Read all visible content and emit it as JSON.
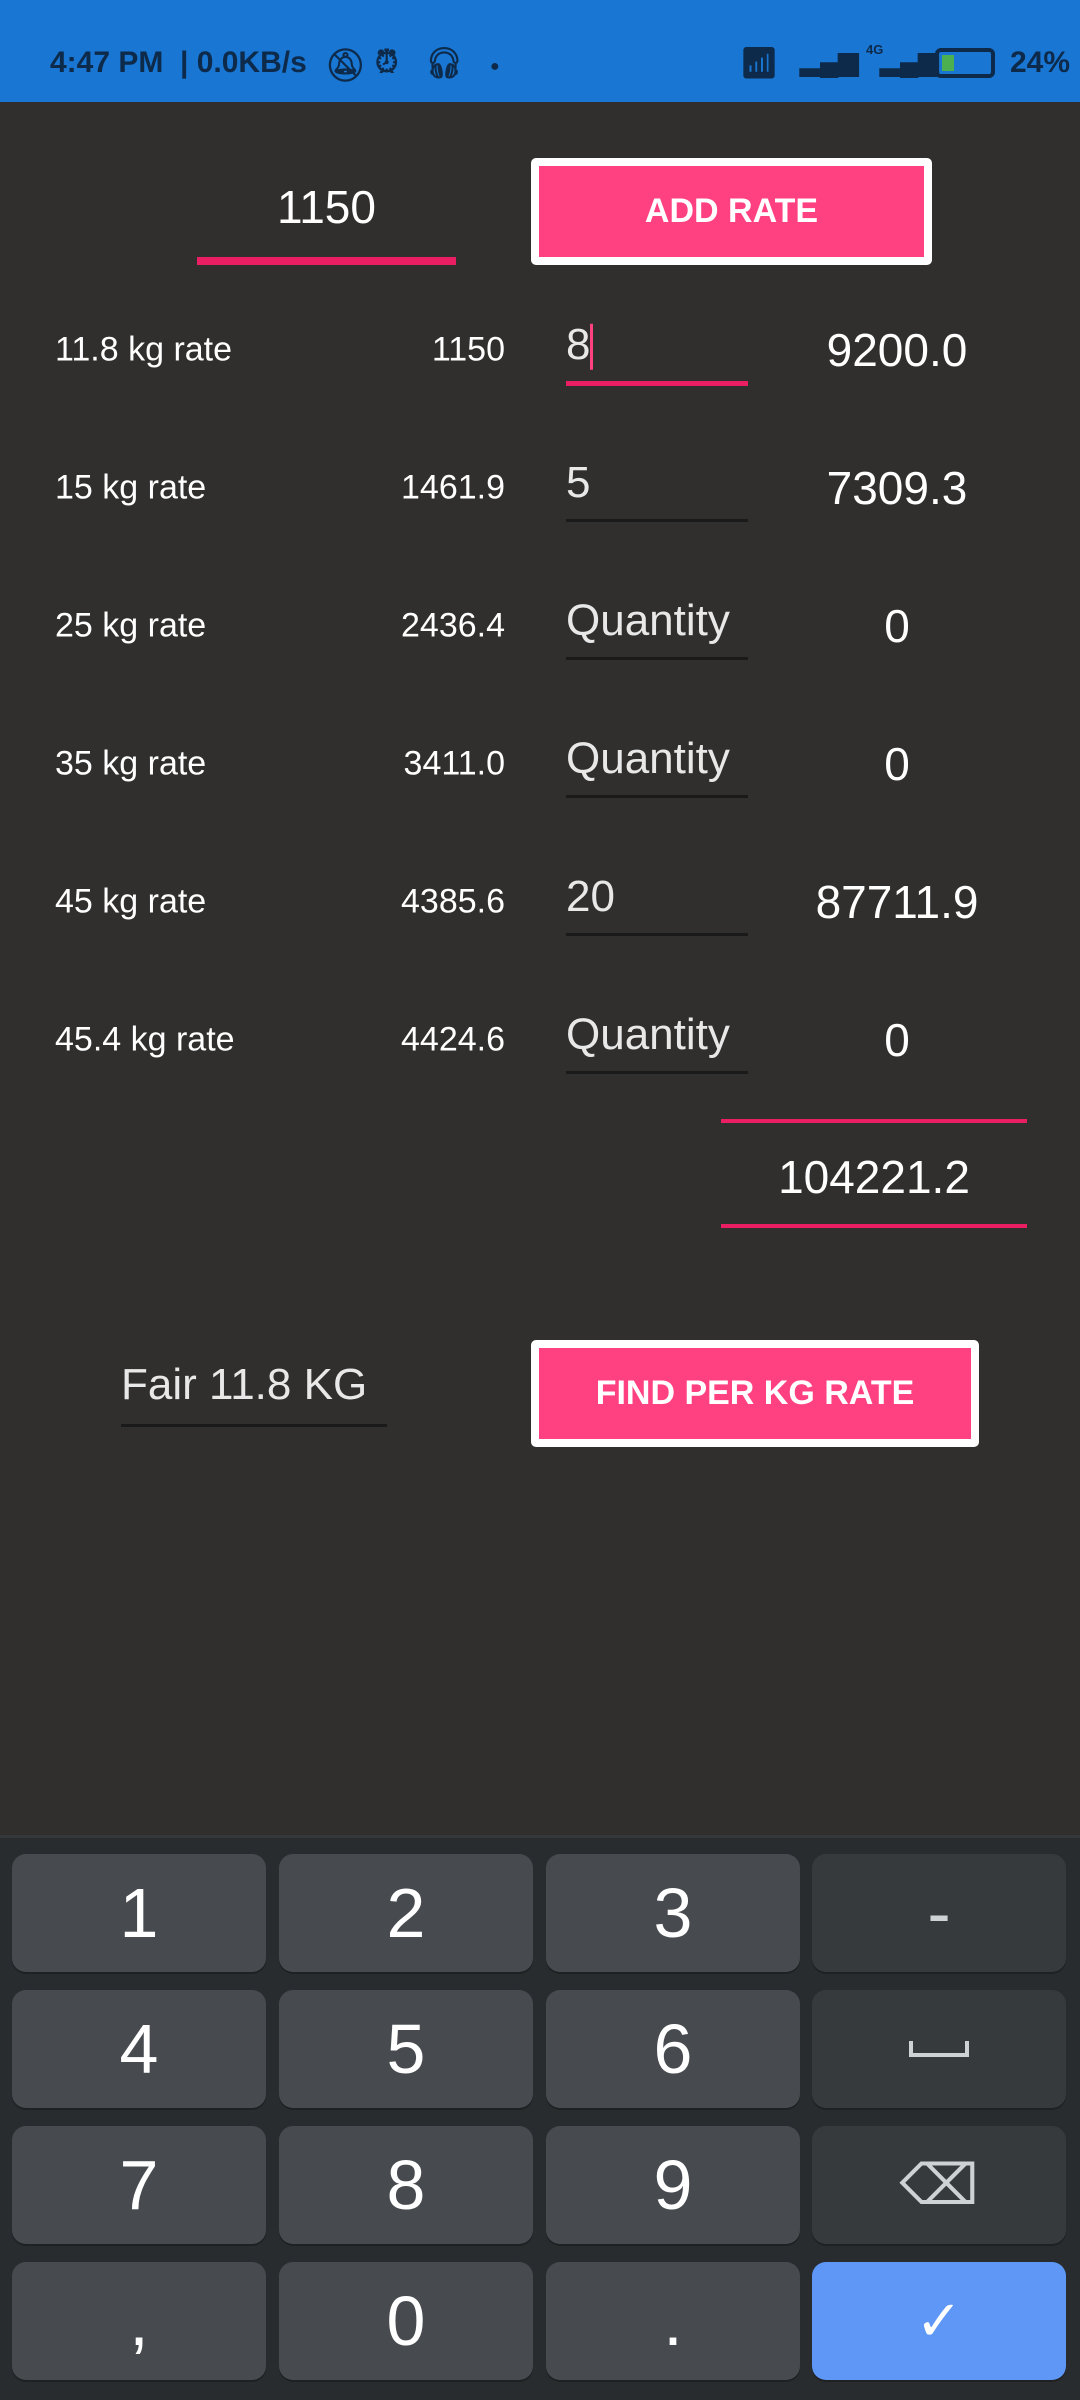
{
  "status_bar": {
    "time": "4:47 PM",
    "speed": "| 0.0KB/s",
    "battery": "24%",
    "network": "4G",
    "icons": [
      "mute-icon",
      "alarm-icon",
      "headset-icon",
      "wifi-icon",
      "signal-icon",
      "battery-charging-icon"
    ]
  },
  "rate_input": {
    "value": "1150"
  },
  "add_rate_button": "ADD RATE",
  "rows": [
    {
      "label": "11.8 kg rate",
      "rate": "1150",
      "quantity": "8",
      "placeholder": "Quantity",
      "total": "9200.0"
    },
    {
      "label": "15 kg rate",
      "rate": "1461.9",
      "quantity": "5",
      "placeholder": "Quantity",
      "total": "7309.3"
    },
    {
      "label": "25 kg rate",
      "rate": "2436.4",
      "quantity": "",
      "placeholder": "Quantity",
      "total": "0"
    },
    {
      "label": "35 kg rate",
      "rate": "3411.0",
      "quantity": "",
      "placeholder": "Quantity",
      "total": "0"
    },
    {
      "label": "45 kg rate",
      "rate": "4385.6",
      "quantity": "20",
      "placeholder": "Quantity",
      "total": "87711.9"
    },
    {
      "label": "45.4 kg rate",
      "rate": "4424.6",
      "quantity": "",
      "placeholder": "Quantity",
      "total": "0"
    }
  ],
  "grand_total": "104221.2",
  "fair_field": {
    "value": "Fair 11.8 KG"
  },
  "find_button": "FIND PER KG RATE",
  "keyboard": {
    "keys": [
      "1",
      "2",
      "3",
      "-",
      "4",
      "5",
      "6",
      "␣",
      "7",
      "8",
      "9",
      "⌫",
      ",",
      "0",
      ".",
      "✓"
    ]
  },
  "colors": {
    "accent": "#ff4081",
    "underline_active": "#e91e63",
    "status_bar": "#1976d2",
    "background": "#302f2e",
    "enter_key": "#5e97f6"
  }
}
